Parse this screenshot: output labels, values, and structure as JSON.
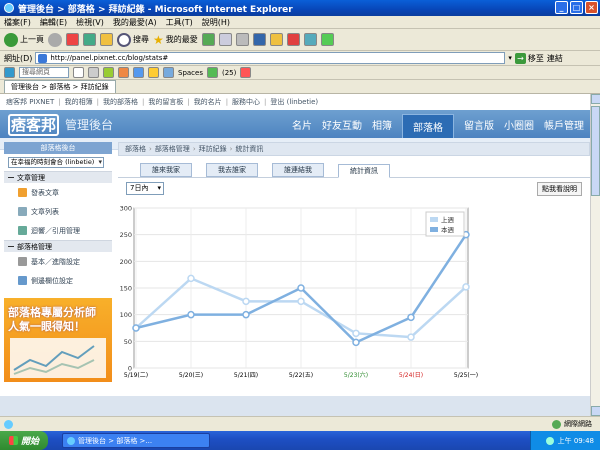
{
  "window": {
    "title": "管理後台 > 部落格 > 拜訪紀錄 - Microsoft Internet Explorer"
  },
  "menu": [
    "檔案(F)",
    "編輯(E)",
    "檢視(V)",
    "我的最愛(A)",
    "工具(T)",
    "說明(H)"
  ],
  "toolbar": {
    "back": "上一頁",
    "search": "搜尋",
    "favorites": "我的最愛"
  },
  "address": {
    "label": "網址(D)",
    "url": "http://panel.pixnet.cc/blog/stats#",
    "go": "移至",
    "links": "連結"
  },
  "linksbar": {
    "search_placeholder": "搜尋網頁",
    "spaces": "Spaces",
    "badge": "(25)"
  },
  "browser_tab": {
    "label": "管理後台 > 部落格 > 拜訪紀錄"
  },
  "toplinks": [
    "痞客邦 PIXNET",
    "我的相簿",
    "我的部落格",
    "我的留言板",
    "我的名片",
    "服務中心",
    "登出 (linbetie)"
  ],
  "banner": {
    "logo": "痞客邦",
    "title": "管理後台",
    "nav": [
      "名片",
      "好友互動",
      "相簿",
      "部落格",
      "留言版",
      "小圈圈",
      "帳戶管理"
    ],
    "active_nav": "部落格"
  },
  "sidebar": {
    "header": "部落格後台",
    "blog_select": "在幸福的時刻會合 (linbetie)",
    "sections": [
      {
        "title": "文章管理",
        "items": [
          "發表文章",
          "文章列表",
          "迴響／引用管理"
        ]
      },
      {
        "title": "部落格管理",
        "items": [
          "基本／進階設定",
          "側邊欄位設定"
        ]
      }
    ],
    "ad": {
      "line1": "部落格專屬分析師",
      "line2": "人氣一眼得知！"
    }
  },
  "breadcrumb": [
    "部落格",
    "部落格管理",
    "拜訪紀錄",
    "統計資訊"
  ],
  "tabs": [
    "誰來我家",
    "我去誰家",
    "誰連結我",
    "統計資訊"
  ],
  "active_tab": "統計資訊",
  "range_select": "7日內",
  "help_button": "點我看說明",
  "status": {
    "zone": "網際網路"
  },
  "taskbar": {
    "start": "開始",
    "task": "管理後台 > 部落格 >...",
    "time": "上午 09:48"
  },
  "colors": {
    "last_week": "#bcd8f2",
    "this_week": "#7fb0e0",
    "weekend_sat": "#2e8b2e",
    "weekend_sun": "#d42020",
    "accent": "#4d83c0"
  },
  "chart_data": {
    "type": "line",
    "categories": [
      "5/19(二)",
      "5/20(三)",
      "5/21(四)",
      "5/22(五)",
      "5/23(六)",
      "5/24(日)",
      "5/25(一)"
    ],
    "category_colors": [
      "#000",
      "#000",
      "#000",
      "#000",
      "#2e8b2e",
      "#d42020",
      "#000"
    ],
    "series": [
      {
        "name": "上週",
        "values": [
          75,
          168,
          125,
          125,
          65,
          58,
          152
        ],
        "color": "#bcd8f2"
      },
      {
        "name": "本週",
        "values": [
          75,
          100,
          100,
          150,
          48,
          95,
          250
        ],
        "color": "#7fb0e0"
      }
    ],
    "ylim": [
      0,
      300
    ],
    "yticks": [
      0,
      50,
      100,
      150,
      200,
      250,
      300
    ],
    "legend": "top-right",
    "grid": true
  }
}
